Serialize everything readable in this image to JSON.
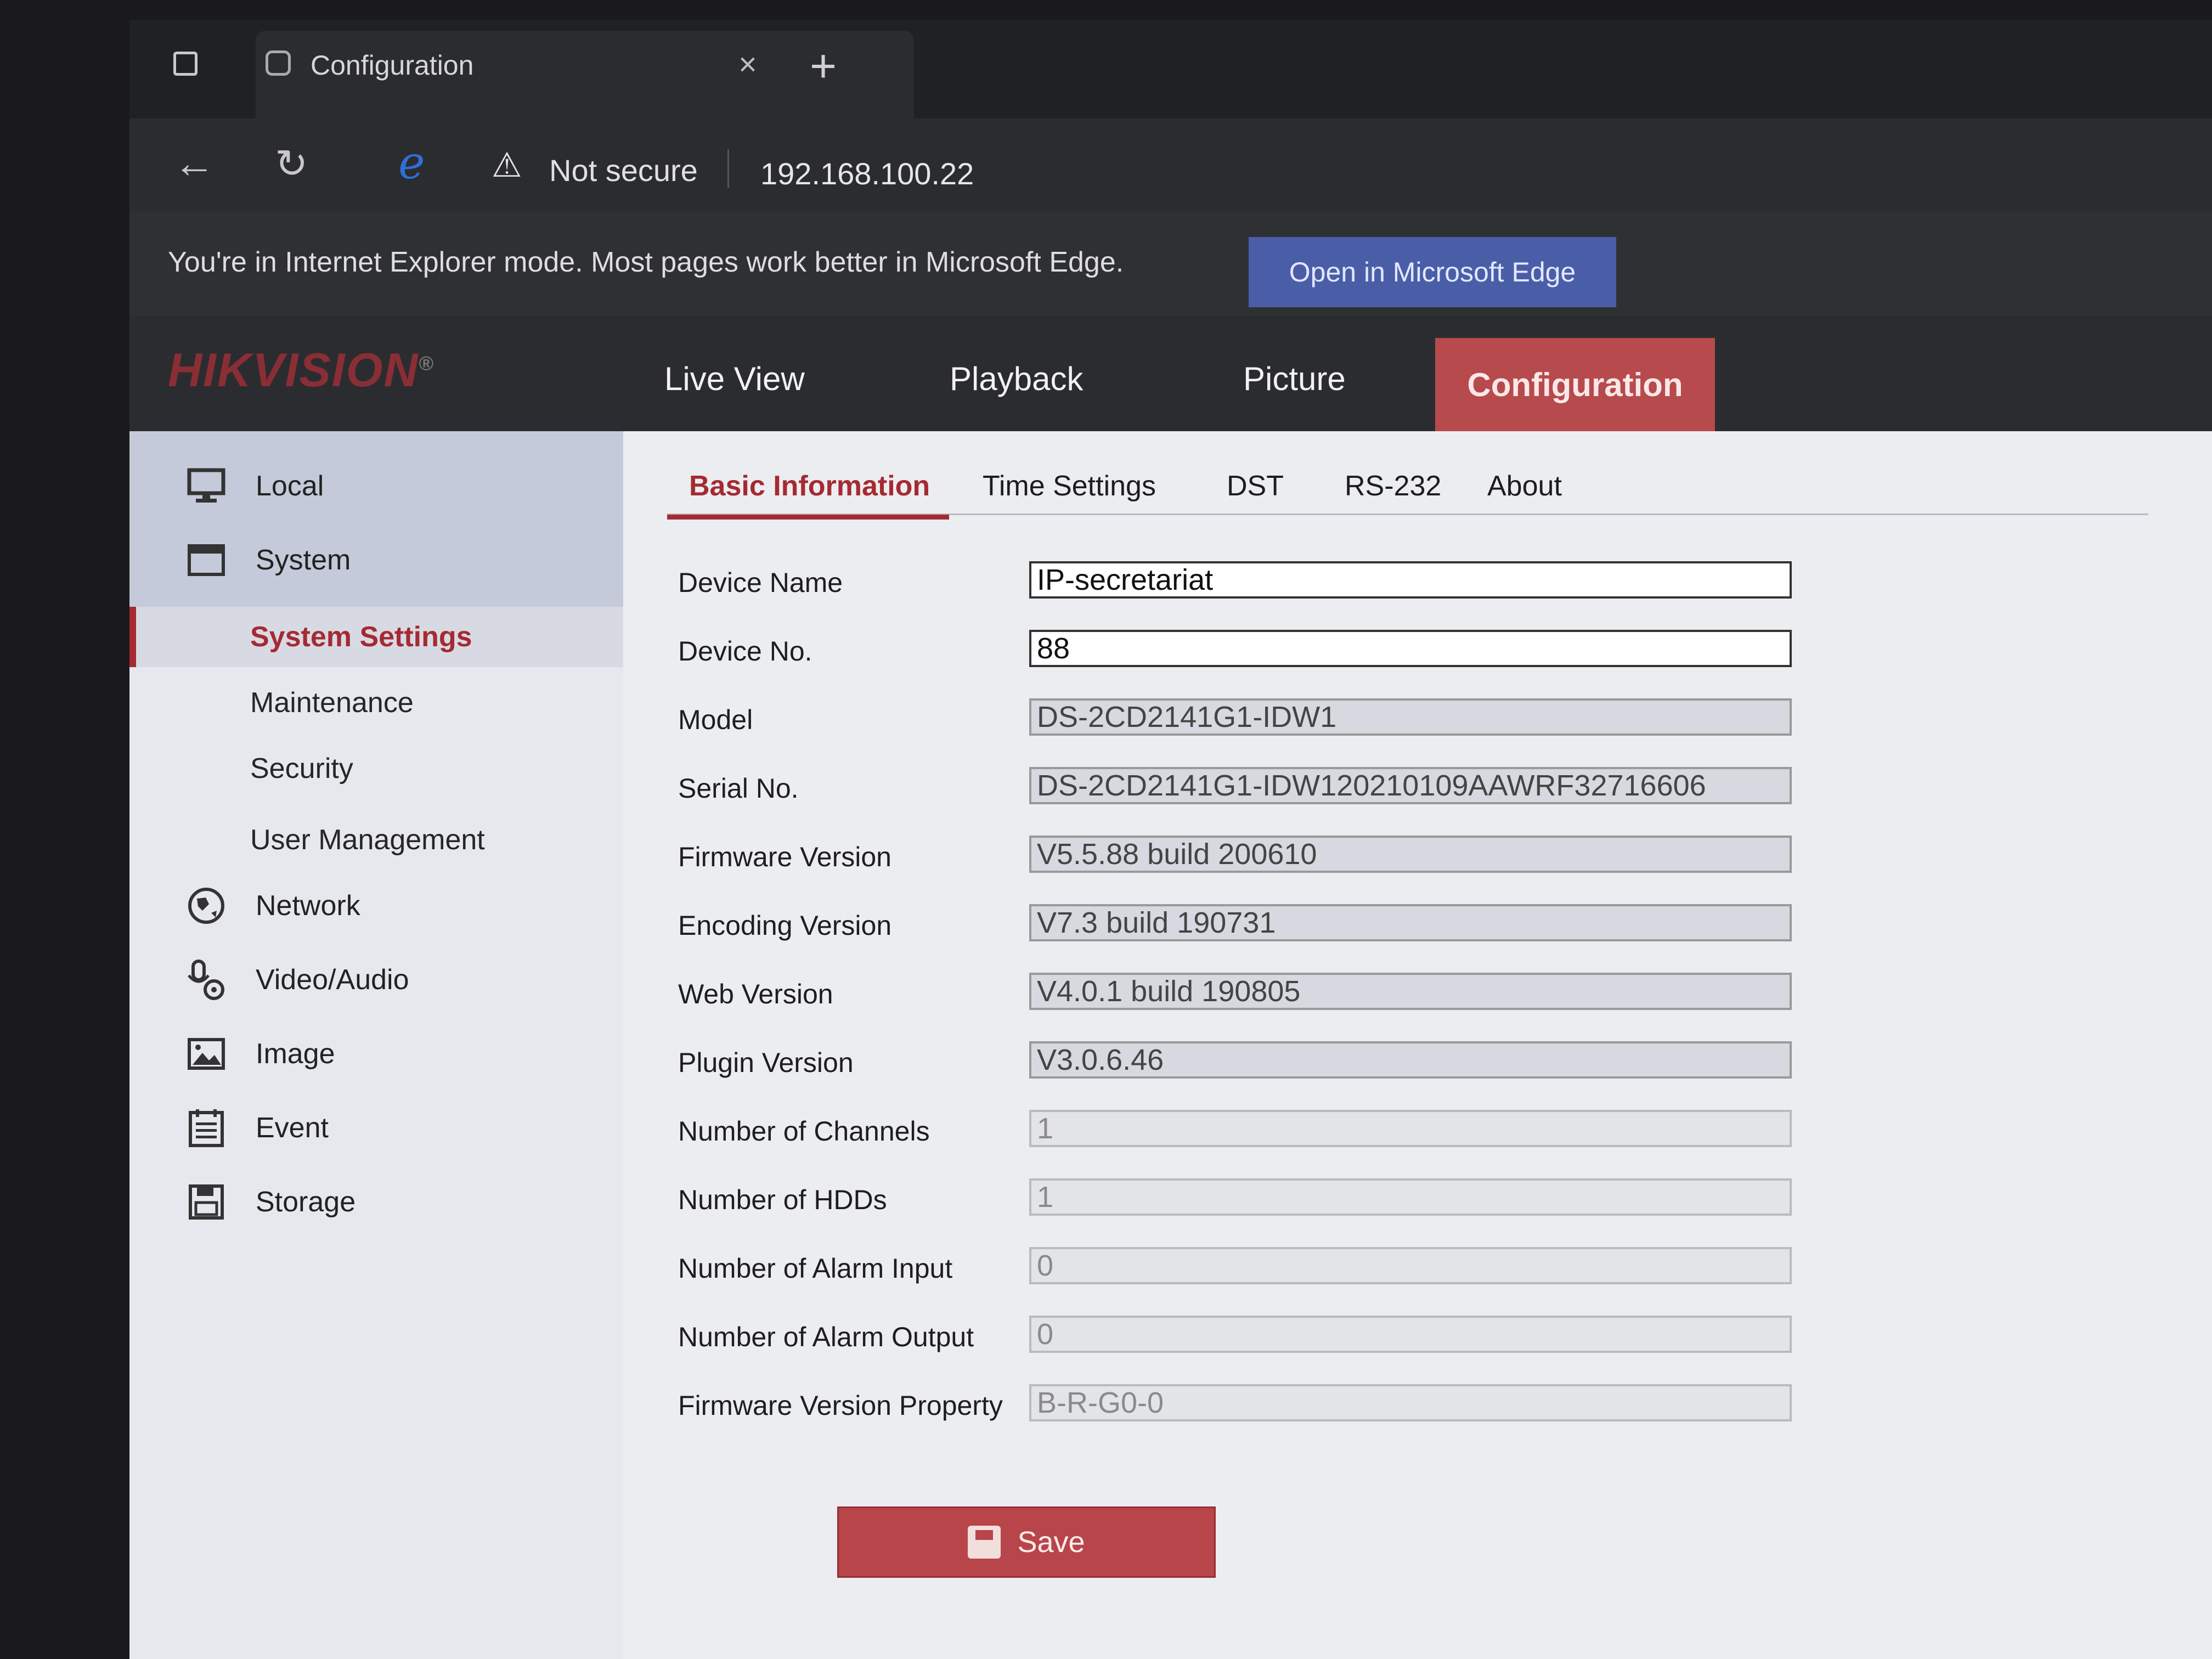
{
  "browser": {
    "tab_title": "Configuration",
    "tab_close": "×",
    "new_tab": "+",
    "security_label": "Not secure",
    "url": "192.168.100.22",
    "ie_mode_message": "You're in Internet Explorer mode. Most pages work better in Microsoft Edge.",
    "open_edge_label": "Open in Microsoft Edge"
  },
  "header": {
    "logo": "HIKVISION",
    "logo_mark": "®",
    "nav": {
      "live_view": "Live View",
      "playback": "Playback",
      "picture": "Picture",
      "configuration": "Configuration"
    },
    "active_nav": "Configuration"
  },
  "sidebar": {
    "local": "Local",
    "system": "System",
    "system_settings": "System Settings",
    "maintenance": "Maintenance",
    "security": "Security",
    "user_management": "User Management",
    "network": "Network",
    "video_audio": "Video/Audio",
    "image": "Image",
    "event": "Event",
    "storage": "Storage",
    "active": "System Settings"
  },
  "tabs": {
    "basic": "Basic Information",
    "time": "Time Settings",
    "dst": "DST",
    "rs232": "RS-232",
    "about": "About",
    "active": "Basic Information"
  },
  "fields": [
    {
      "label": "Device Name",
      "value": "IP-secretariat"
    },
    {
      "label": "Device No.",
      "value": "88"
    },
    {
      "label": "Model",
      "value": "DS-2CD2141G1-IDW1"
    },
    {
      "label": "Serial No.",
      "value": "DS-2CD2141G1-IDW120210109AAWRF32716606"
    },
    {
      "label": "Firmware Version",
      "value": "V5.5.88 build 200610"
    },
    {
      "label": "Encoding Version",
      "value": "V7.3 build 190731"
    },
    {
      "label": "Web Version",
      "value": "V4.0.1 build 190805"
    },
    {
      "label": "Plugin Version",
      "value": "V3.0.6.46"
    },
    {
      "label": "Number of Channels",
      "value": "1"
    },
    {
      "label": "Number of HDDs",
      "value": "1"
    },
    {
      "label": "Number of Alarm Input",
      "value": "0"
    },
    {
      "label": "Number of Alarm Output",
      "value": "0"
    },
    {
      "label": "Firmware Version Property",
      "value": "B-R-G0-0"
    }
  ],
  "save_label": "Save",
  "colors": {
    "accent": "#a52a32",
    "config_tab": "#b64a4d",
    "edge_button": "#4a5ea8"
  }
}
